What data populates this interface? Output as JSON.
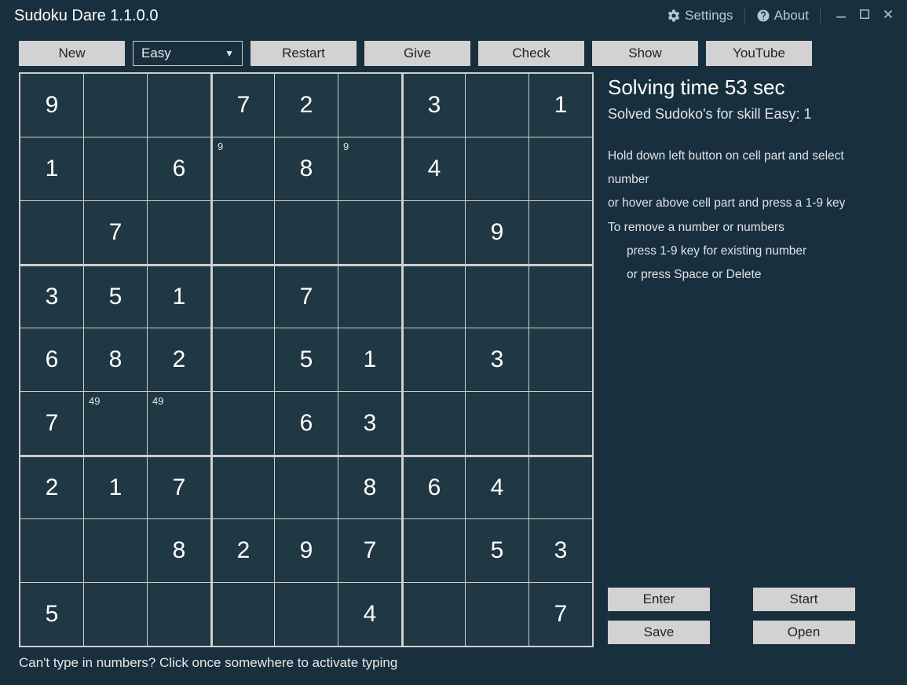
{
  "app": {
    "title": "Sudoku Dare 1.1.0.0"
  },
  "window": {
    "settings": "Settings",
    "about": "About"
  },
  "toolbar": {
    "new_label": "New",
    "difficulty_selected": "Easy",
    "restart_label": "Restart",
    "give_label": "Give",
    "check_label": "Check",
    "show_label": "Show",
    "youtube_label": "YouTube"
  },
  "side": {
    "time_label": "Solving time 53 sec",
    "solved_label": "Solved Sudoko's for skill Easy: 1",
    "help_line1": "Hold down left button on cell part and select number",
    "help_line2": "or hover above cell part and press a 1-9 key",
    "help_line3": "To remove a number or numbers",
    "help_line4": "press 1-9 key for existing number",
    "help_line5": "or press Space or Delete",
    "enter_label": "Enter",
    "start_label": "Start",
    "save_label": "Save",
    "open_label": "Open"
  },
  "footer": {
    "note": "Can't type in numbers? Click once somewhere to activate typing"
  },
  "board": {
    "values": [
      [
        "9",
        "",
        "",
        "7",
        "2",
        "",
        "3",
        "",
        "1"
      ],
      [
        "1",
        "",
        "6",
        "",
        "8",
        "",
        "4",
        "",
        ""
      ],
      [
        "",
        "7",
        "",
        "",
        "",
        "",
        "",
        "9",
        ""
      ],
      [
        "3",
        "5",
        "1",
        "",
        "7",
        "",
        "",
        "",
        ""
      ],
      [
        "6",
        "8",
        "2",
        "",
        "5",
        "1",
        "",
        "3",
        ""
      ],
      [
        "7",
        "",
        "",
        "",
        "6",
        "3",
        "",
        "",
        ""
      ],
      [
        "2",
        "1",
        "7",
        "",
        "",
        "8",
        "6",
        "4",
        ""
      ],
      [
        "",
        "",
        "8",
        "2",
        "9",
        "7",
        "",
        "5",
        "3"
      ],
      [
        "5",
        "",
        "",
        "",
        "",
        "4",
        "",
        "",
        "7"
      ]
    ],
    "pencil": {
      "1,3": "9",
      "1,5": "9",
      "5,1": "49",
      "5,2": "49"
    }
  }
}
